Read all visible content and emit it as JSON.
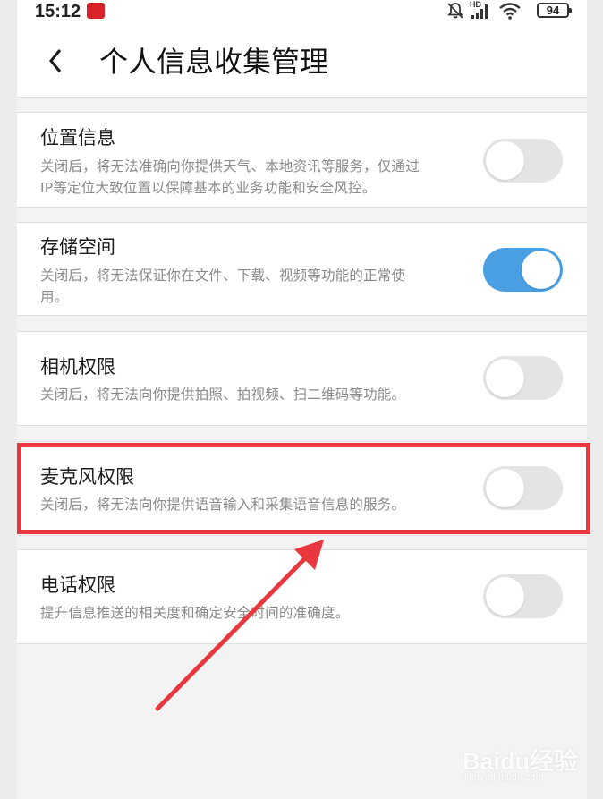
{
  "status_bar": {
    "time": "15:12",
    "battery": "94",
    "network_label": "HD",
    "icons": [
      "app-notification-icon",
      "mute-bell-icon",
      "signal-icon",
      "wifi-icon",
      "battery-icon"
    ]
  },
  "header": {
    "back_icon": "chevron-left-icon",
    "title": "个人信息收集管理"
  },
  "permissions": [
    {
      "title": "位置信息",
      "description_lines": [
        "关闭后，将无法准确向你提供天气、本地资讯等服务，仅通过",
        "IP等定位大致位置以保障基本的业务功能和安全风控。"
      ],
      "enabled": false
    },
    {
      "title": "存储空间",
      "description_lines": [
        "关闭后，将无法保证你在文件、下载、视频等功能的正常使",
        "用。"
      ],
      "enabled": true
    },
    {
      "title": "相机权限",
      "description_lines": [
        "关闭后，将无法向你提供拍照、拍视频、扫二维码等功能。"
      ],
      "enabled": false
    },
    {
      "title": "麦克风权限",
      "description_lines": [
        "关闭后，将无法向你提供语音输入和采集语音信息的服务。"
      ],
      "enabled": false,
      "highlighted": true
    },
    {
      "title": "电话权限",
      "description_lines": [
        "提升信息推送的相关度和确定安全时间的准确度。"
      ],
      "enabled": false
    }
  ],
  "colors": {
    "toggle_on": "#4a9fe3",
    "toggle_off": "#e4e4e4",
    "highlight": "#e8383d"
  },
  "watermark": {
    "logo": "Baidu经验",
    "url": "jingyan.baidu.com"
  }
}
